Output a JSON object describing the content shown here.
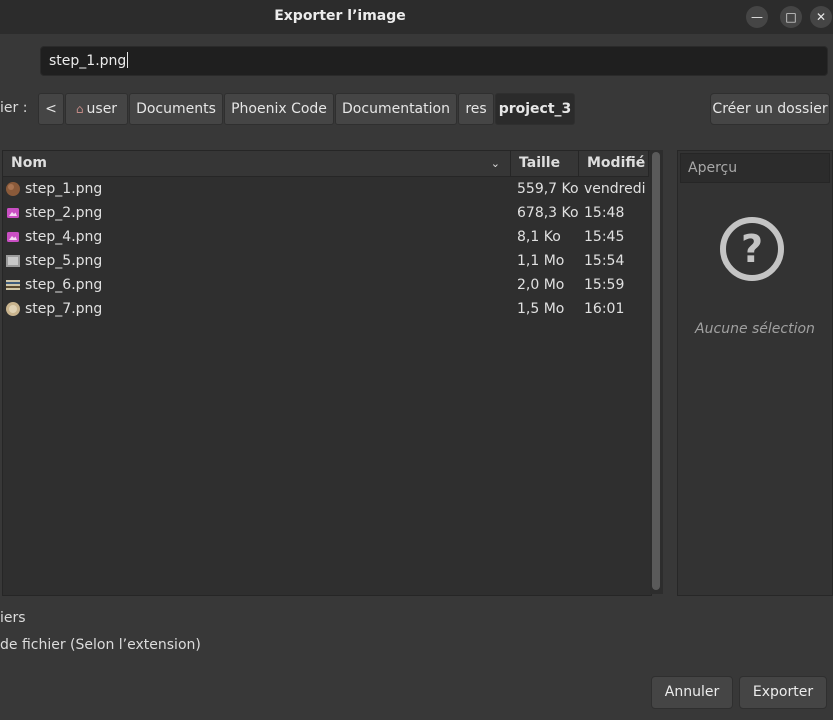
{
  "window": {
    "title": "Exporter l’image",
    "minimize_glyph": "—",
    "maximize_glyph": "□",
    "close_glyph": "✕"
  },
  "filename": {
    "value": "step_1.png"
  },
  "folder_label": "ier :",
  "breadcrumb": {
    "back_glyph": "<",
    "items": [
      {
        "label": "user",
        "icon": "home-icon"
      },
      {
        "label": "Documents"
      },
      {
        "label": "Phoenix Code"
      },
      {
        "label": "Documentation"
      },
      {
        "label": "res"
      },
      {
        "label": "project_3"
      }
    ]
  },
  "create_folder_label": "Créer un dossier",
  "files": {
    "columns": {
      "name": "Nom",
      "size": "Taille",
      "modified": "Modifié"
    },
    "rows": [
      {
        "name": "step_1.png",
        "size": "559,7 Ko",
        "modified": "vendredi",
        "icon": "round-brown-thumbnail-icon"
      },
      {
        "name": "step_2.png",
        "size": "678,3 Ko",
        "modified": "15:48",
        "icon": "image-file-icon"
      },
      {
        "name": "step_4.png",
        "size": "8,1 Ko",
        "modified": "15:45",
        "icon": "image-file-icon"
      },
      {
        "name": "step_5.png",
        "size": "1,1 Mo",
        "modified": "15:54",
        "icon": "gray-thumbnail-icon"
      },
      {
        "name": "step_6.png",
        "size": "2,0 Mo",
        "modified": "15:59",
        "icon": "striped-thumbnail-icon"
      },
      {
        "name": "step_7.png",
        "size": "1,5 Mo",
        "modified": "16:01",
        "icon": "round-beige-thumbnail-icon"
      }
    ]
  },
  "preview": {
    "header": "Aperçu",
    "empty_text": "Aucune sélection"
  },
  "options": {
    "show_all": "iers",
    "file_type": "de fichier (Selon l’extension)"
  },
  "buttons": {
    "cancel": "Annuler",
    "export": "Exporter"
  },
  "colors": {
    "image_icon": "#c94fc3",
    "home_icon": "#c28a86"
  }
}
